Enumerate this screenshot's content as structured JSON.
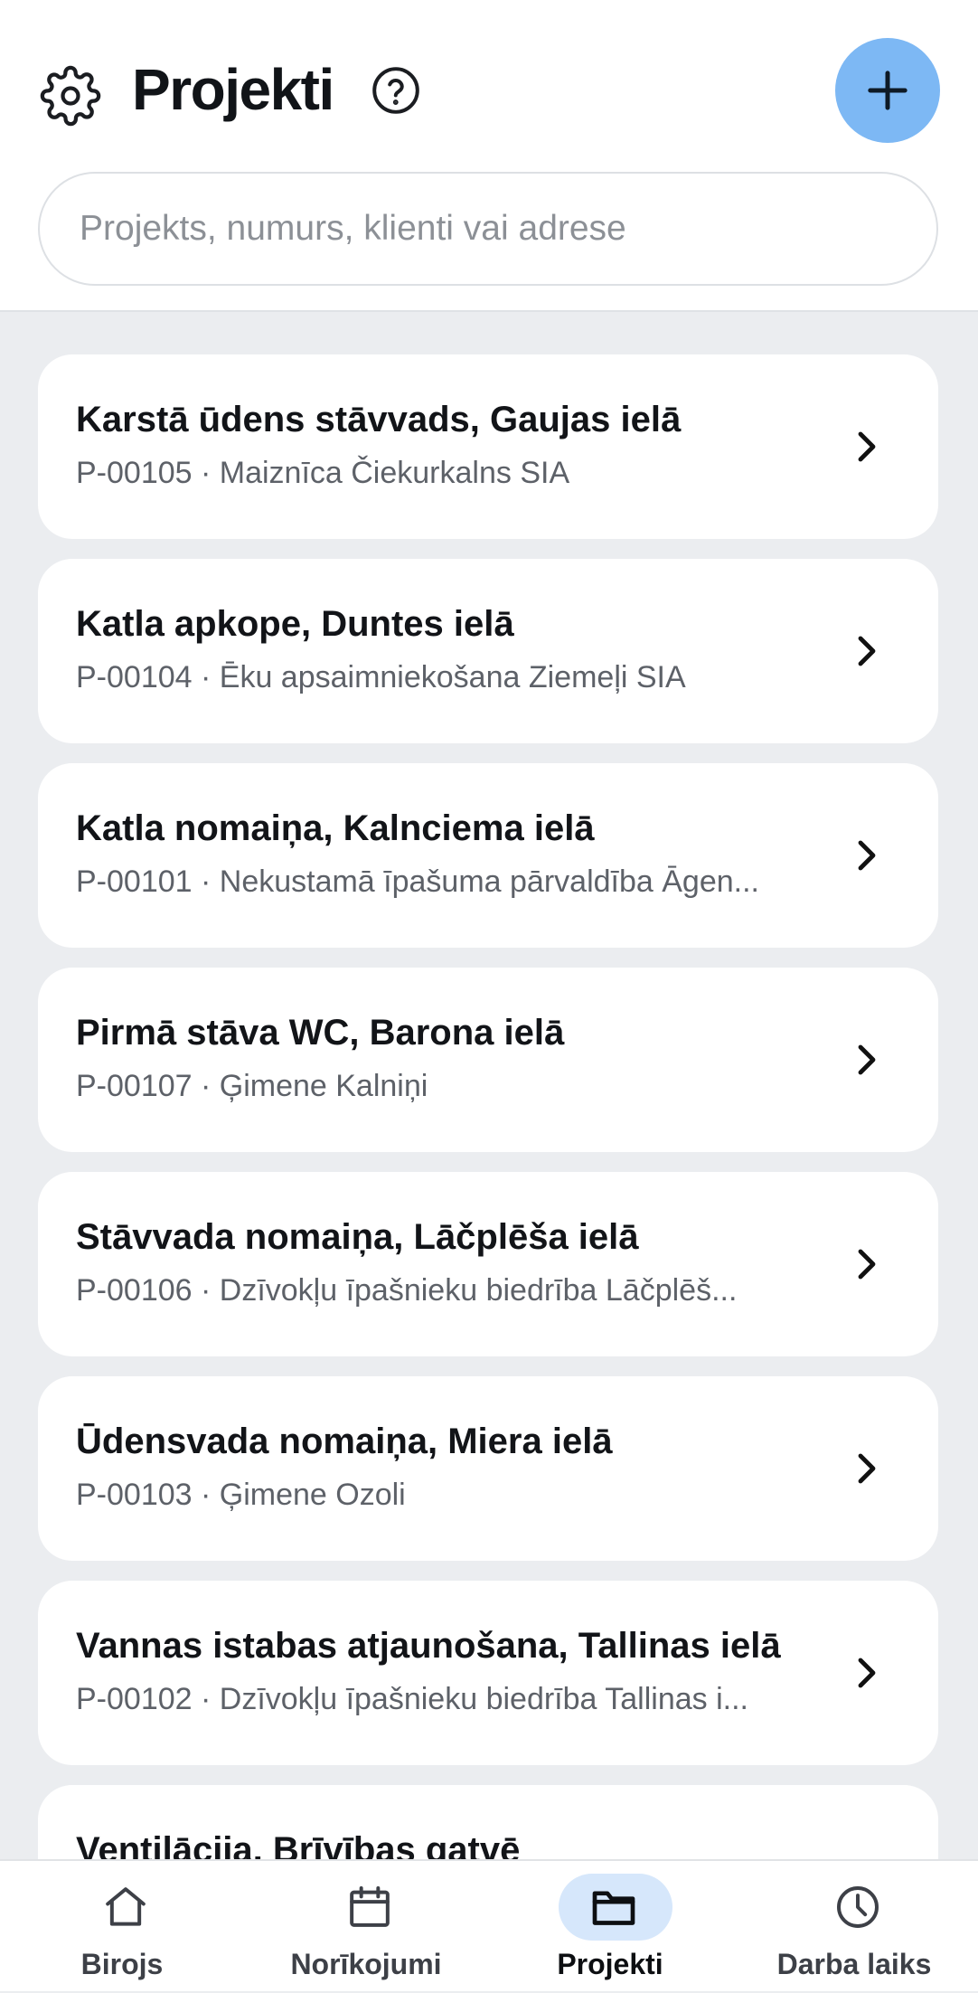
{
  "header": {
    "title": "Projekti",
    "search_placeholder": "Projekts, numurs, klienti vai adrese"
  },
  "projects": [
    {
      "title": "Karstā ūdens stāvvads, Gaujas ielā",
      "subtitle": "P-00105 · Maiznīca Čiekurkalns SIA"
    },
    {
      "title": "Katla apkope, Duntes ielā",
      "subtitle": "P-00104 · Ēku apsaimniekošana Ziemeļi SIA"
    },
    {
      "title": "Katla nomaiņa, Kalnciema ielā",
      "subtitle": "P-00101 · Nekustamā īpašuma pārvaldība Āgen..."
    },
    {
      "title": "Pirmā stāva WC, Barona ielā",
      "subtitle": "P-00107 · Ģimene Kalniņi"
    },
    {
      "title": "Stāvvada nomaiņa, Lāčplēša ielā",
      "subtitle": "P-00106 · Dzīvokļu īpašnieku biedrība Lāčplēš..."
    },
    {
      "title": "Ūdensvada nomaiņa, Miera ielā",
      "subtitle": "P-00103 · Ģimene Ozoli"
    },
    {
      "title": "Vannas istabas atjaunošana, Tallinas ielā",
      "subtitle": "P-00102 · Dzīvokļu īpašnieku biedrība Tallinas i..."
    },
    {
      "title": "Ventilācija, Brīvības gatvē",
      "subtitle": ""
    }
  ],
  "nav": {
    "items": [
      {
        "label": "Birojs",
        "icon": "home-icon"
      },
      {
        "label": "Norīkojumi",
        "icon": "calendar-icon"
      },
      {
        "label": "Projekti",
        "icon": "folder-icon",
        "active": true
      },
      {
        "label": "Darba laiks",
        "icon": "clock-icon"
      }
    ]
  },
  "colors": {
    "accent": "#7db8f4",
    "active_pill": "#d6e7fb",
    "background": "#ebedf0"
  }
}
